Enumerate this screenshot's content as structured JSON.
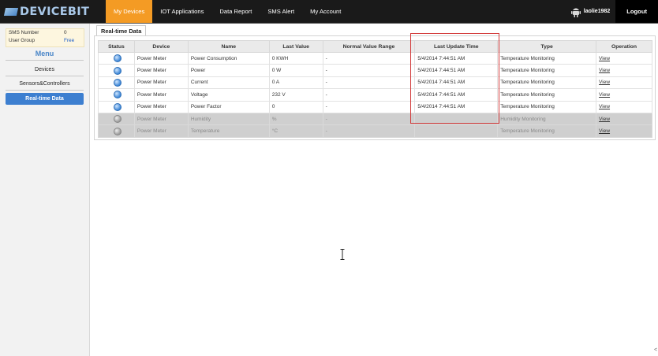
{
  "brand": {
    "logo_text": "DEVICEBIT",
    "logo_icon": "devicebit-logo"
  },
  "nav": {
    "items": [
      {
        "label": "My Devices",
        "active": true
      },
      {
        "label": "IOT Applications",
        "active": false
      },
      {
        "label": "Data Report",
        "active": false
      },
      {
        "label": "SMS Alert",
        "active": false
      },
      {
        "label": "My Account",
        "active": false
      }
    ],
    "user_icon": "android-icon",
    "username": "laolie1982",
    "logout_label": "Logout"
  },
  "sidebar": {
    "sms": {
      "number_label": "SMS Number",
      "number_value": "0",
      "group_label": "User Group",
      "group_value": "Free"
    },
    "menu_title": "Menu",
    "items": [
      {
        "label": "Devices",
        "active": false
      },
      {
        "label": "Sensors&Controllers",
        "active": false
      },
      {
        "label": "Real-time Data",
        "active": true
      }
    ]
  },
  "main": {
    "tab_label": "Real-time Data",
    "table": {
      "headers": [
        "Status",
        "Device",
        "Name",
        "Last Value",
        "Normal Value Range",
        "Last Update Time",
        "Type",
        "Operation"
      ],
      "rows": [
        {
          "status": "active",
          "device": "Power Meter",
          "name": "Power Consumption",
          "last_value": "0 KWH",
          "range": "-",
          "last_update": "5/4/2014 7:44:51 AM",
          "type": "Temperature Monitoring",
          "operation": "View"
        },
        {
          "status": "active",
          "device": "Power Meter",
          "name": "Power",
          "last_value": "0 W",
          "range": "-",
          "last_update": "5/4/2014 7:44:51 AM",
          "type": "Temperature Monitoring",
          "operation": "View"
        },
        {
          "status": "active",
          "device": "Power Meter",
          "name": "Current",
          "last_value": "0 A",
          "range": "-",
          "last_update": "5/4/2014 7:44:51 AM",
          "type": "Temperature Monitoring",
          "operation": "View"
        },
        {
          "status": "active",
          "device": "Power Meter",
          "name": "Voltage",
          "last_value": "232 V",
          "range": "-",
          "last_update": "5/4/2014 7:44:51 AM",
          "type": "Temperature Monitoring",
          "operation": "View"
        },
        {
          "status": "active",
          "device": "Power Meter",
          "name": "Power Factor",
          "last_value": "0",
          "range": "-",
          "last_update": "5/4/2014 7:44:51 AM",
          "type": "Temperature Monitoring",
          "operation": "View"
        },
        {
          "status": "inactive",
          "device": "Power Meter",
          "name": "Humidity",
          "last_value": "%",
          "range": "-",
          "last_update": "",
          "type": "Humidity Monitoring",
          "operation": "View"
        },
        {
          "status": "inactive",
          "device": "Power Meter",
          "name": "Temperature",
          "last_value": "°C",
          "range": "-",
          "last_update": "",
          "type": "Temperature Monitoring",
          "operation": "View"
        }
      ]
    }
  },
  "colors": {
    "topbar": "#1a1a1a",
    "nav_active": "#f49b24",
    "sidebar_active": "#3d7fd0",
    "highlight_border": "#d23a3a",
    "inactive_row": "#cfcfcf"
  },
  "corner_glyph": "<"
}
